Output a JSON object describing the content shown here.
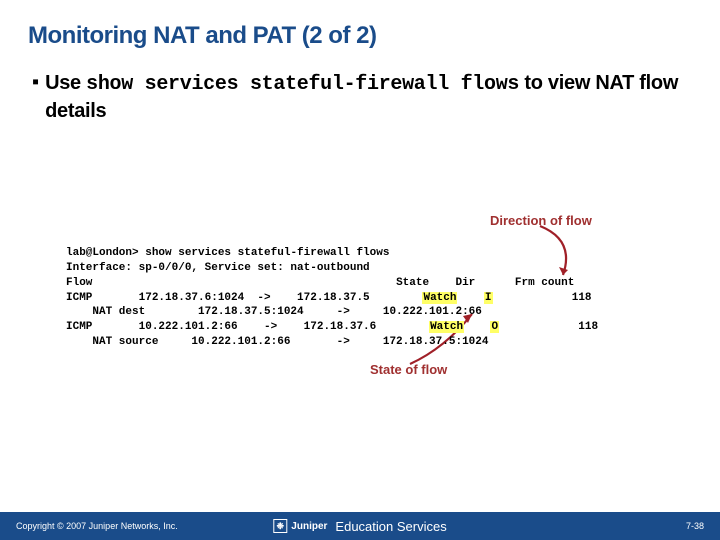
{
  "title": "Monitoring NAT and PAT (2 of 2)",
  "bullet": {
    "prefix": "Use ",
    "code": "show services stateful-firewall flows",
    "suffix": " to view NAT flow details"
  },
  "labels": {
    "direction": "Direction of flow",
    "state": "State of flow"
  },
  "terminal": {
    "prompt": "lab@London> ",
    "command": "show services stateful-firewall flows",
    "line2": "Interface: sp-0/0/0, Service set: nat-outbound",
    "hdr_flow": "Flow",
    "hdr_state": "State",
    "hdr_dir": "Dir",
    "hdr_frm": "Frm count",
    "row1_a": "ICMP       172.18.37.6:1024  ->    172.18.37.5        ",
    "row1_state": "Watch",
    "row1_mid": "    ",
    "row1_dir": "I",
    "row1_frm": "            118",
    "row2": "    NAT dest        172.18.37.5:1024     ->     10.222.101.2:66",
    "row3_a": "ICMP       10.222.101.2:66    ->    172.18.37.6        ",
    "row3_state": "Watch",
    "row3_mid": "    ",
    "row3_dir": "O",
    "row3_frm": "            118",
    "row4": "    NAT source     10.222.101.2:66       ->     172.18.37.5:1024"
  },
  "footer": {
    "copyright": "Copyright © 2007 Juniper Networks, Inc.",
    "brand": "Juniper",
    "service": "Education Services",
    "page": "7-38"
  }
}
